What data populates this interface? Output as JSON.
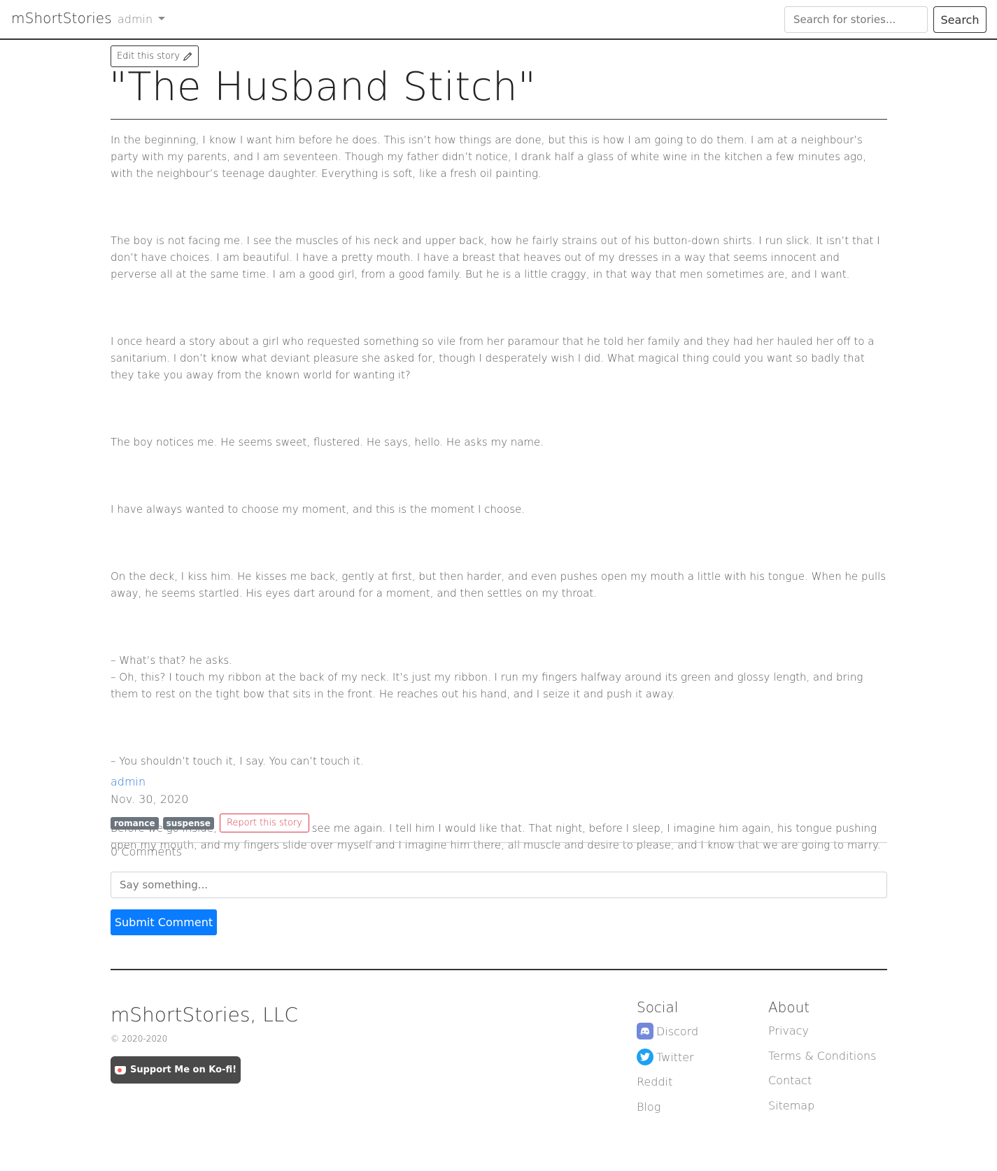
{
  "navbar": {
    "brand": "mShortStories",
    "user": "admin",
    "search_placeholder": "Search for stories...",
    "search_button": "Search"
  },
  "story": {
    "edit_label": "Edit this story",
    "title": "\"The Husband Stitch\"",
    "paragraphs": [
      "In the beginning, I know I want him before he does. This isn’t how things are done, but this is how I am going to do them. I am at a neighbour’s party with my parents, and I am seventeen. Though my father didn’t notice, I drank half a glass of white wine in the kitchen a few minutes ago, with the neighbour’s teenage daughter. Everything is soft, like a fresh oil painting.",
      "The boy is not facing me. I see the muscles of his neck and upper back, how he fairly strains out of his button-down shirts. I run slick. It isn’t that I don’t have choices. I am beautiful. I have a pretty mouth. I have a breast that heaves out of my dresses in a way that seems innocent and perverse all at the same time. I am a good girl, from a good family. But he is a little craggy, in that way that men sometimes are, and I want.",
      "I once heard a story about a girl who requested something so vile from her paramour that he told her family and they had her hauled her off to a sanitarium. I don’t know what deviant pleasure she asked for, though I desperately wish I did. What magical thing could you want so badly that they take you away from the known world for wanting it?",
      "The boy notices me. He seems sweet, flustered. He says, hello. He asks my name.",
      "I have always wanted to choose my moment, and this is the moment I choose.",
      "On the deck, I kiss him. He kisses me back, gently at first, but then harder, and even pushes open my mouth a little with his tongue. When he pulls away, he seems startled. His eyes dart around for a moment, and then settles on my throat.",
      "– What’s that? he asks.\n– Oh, this? I touch my ribbon at the back of my neck. It’s just my ribbon. I run my fingers halfway around its green and glossy length, and bring them to rest on the tight bow that sits in the front. He reaches out his hand, and I seize it and push it away.",
      "– You shouldn’t touch it, I say. You can’t touch it.",
      "Before we go inside, he asks if he can see me again. I tell him I would like that. That night, before I sleep, I imagine him again, his tongue pushing open my mouth, and my fingers slide over myself and I imagine him there, all muscle and desire to please, and I know that we are going to marry."
    ],
    "author": "admin",
    "date": "Nov. 30, 2020",
    "tags": [
      "romance",
      "suspense"
    ],
    "report_label": "Report this story"
  },
  "comments": {
    "count_label": "0 Comments",
    "placeholder": "Say something...",
    "submit_label": "Submit Comment"
  },
  "footer": {
    "brand": "mShortStories, LLC",
    "copyright": "© 2020-2020",
    "kofi_label": "Support Me on Ko-fi!",
    "social_heading": "Social",
    "social_links": [
      "Discord",
      "Twitter",
      "Reddit",
      "Blog"
    ],
    "about_heading": "About",
    "about_links": [
      "Privacy",
      "Terms & Conditions",
      "Contact",
      "Sitemap"
    ]
  },
  "colors": {
    "primary": "#0a7cff",
    "danger": "#dc3545",
    "badge": "#6c757d",
    "link": "#2a7bd8",
    "discord": "#7289da",
    "twitter": "#1da1f2"
  }
}
